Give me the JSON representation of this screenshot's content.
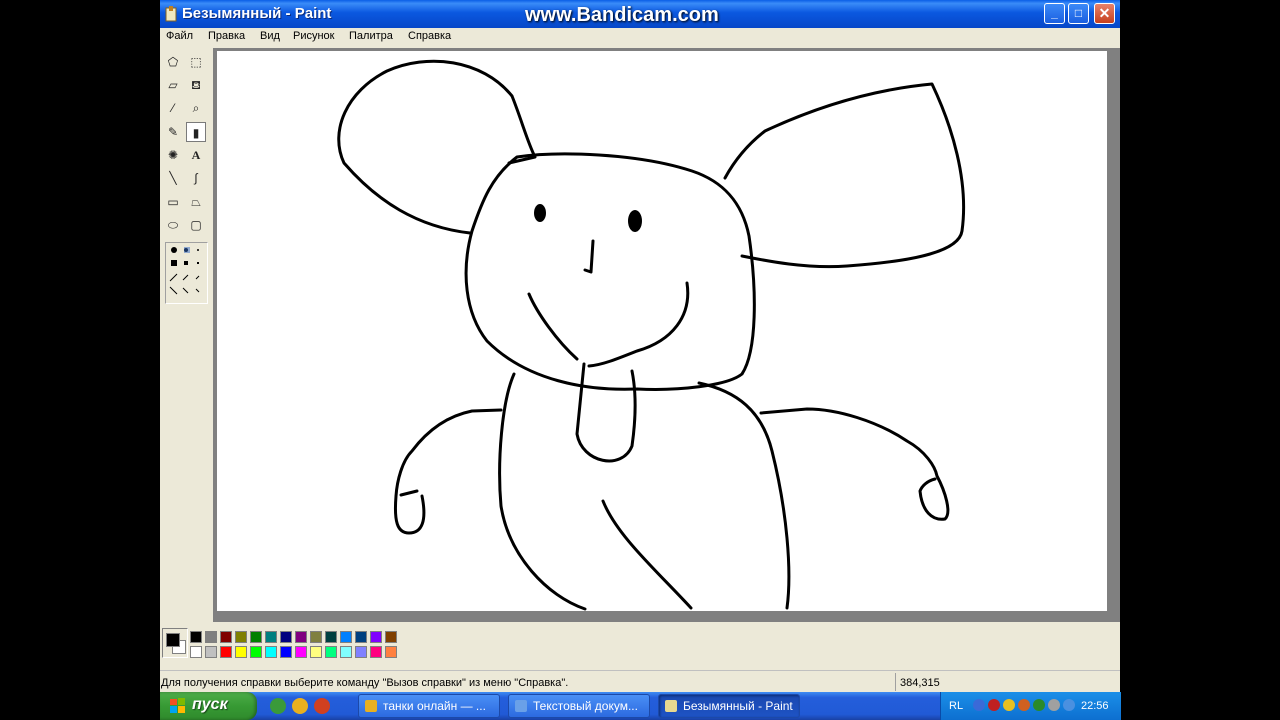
{
  "window": {
    "title": "Безымянный - Paint",
    "watermark": "www.Bandicam.com",
    "controls": {
      "minimize": "_",
      "maximize": "□",
      "close": "✕"
    }
  },
  "menu": [
    "Файл",
    "Правка",
    "Вид",
    "Рисунок",
    "Палитра",
    "Справка"
  ],
  "tools": [
    {
      "name": "free-select-tool",
      "glyph": "⬠"
    },
    {
      "name": "rect-select-tool",
      "glyph": "⬚"
    },
    {
      "name": "eraser-tool",
      "glyph": "▱"
    },
    {
      "name": "fill-tool",
      "glyph": "⛾"
    },
    {
      "name": "color-picker-tool",
      "glyph": "⁄"
    },
    {
      "name": "magnifier-tool",
      "glyph": "⌕"
    },
    {
      "name": "pencil-tool",
      "glyph": "✎"
    },
    {
      "name": "brush-tool",
      "glyph": "▮"
    },
    {
      "name": "airbrush-tool",
      "glyph": "✺"
    },
    {
      "name": "text-tool",
      "glyph": "A"
    },
    {
      "name": "line-tool",
      "glyph": "╲"
    },
    {
      "name": "curve-tool",
      "glyph": "∫"
    },
    {
      "name": "rectangle-tool",
      "glyph": "▭"
    },
    {
      "name": "polygon-tool",
      "glyph": "⏢"
    },
    {
      "name": "ellipse-tool",
      "glyph": "⬭"
    },
    {
      "name": "rounded-rect-tool",
      "glyph": "▢"
    }
  ],
  "selected_tool": "brush-tool",
  "palette": {
    "foreground": "#000000",
    "background": "#ffffff",
    "row1": [
      "#000000",
      "#808080",
      "#800000",
      "#808000",
      "#008000",
      "#008080",
      "#000080",
      "#800080",
      "#808040",
      "#004040",
      "#0080ff",
      "#004080",
      "#8000ff",
      "#804000"
    ],
    "row2": [
      "#ffffff",
      "#c0c0c0",
      "#ff0000",
      "#ffff00",
      "#00ff00",
      "#00ffff",
      "#0000ff",
      "#ff00ff",
      "#ffff80",
      "#00ff80",
      "#80ffff",
      "#8080ff",
      "#ff0080",
      "#ff8040"
    ]
  },
  "status": {
    "help_text": "Для получения справки выберите команду \"Вызов справки\" из меню \"Справка\".",
    "coords": "384,315"
  },
  "taskbar": {
    "start_label": "пуск",
    "quick_launch": [
      "#3a9a3a",
      "#e8b020",
      "#d04020"
    ],
    "buttons": [
      {
        "label": "танки онлайн — ...",
        "icon_color": "#e8b020"
      },
      {
        "label": "Текстовый докум...",
        "icon_color": "#6aa0e8"
      },
      {
        "label": "Безымянный - Paint",
        "icon_color": "#e8d890"
      }
    ],
    "tray_lang": "RL",
    "tray_icons": [
      "#3a6ad8",
      "#c02020",
      "#e8c020",
      "#d06020",
      "#2a8a2a",
      "#a0a0a0",
      "#4a90e0"
    ],
    "clock": "22:56"
  }
}
